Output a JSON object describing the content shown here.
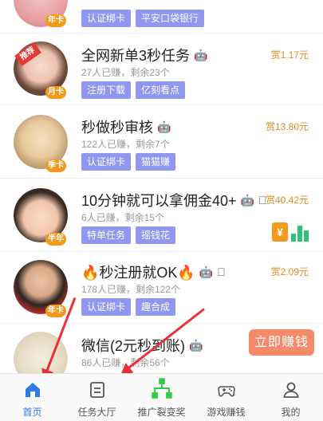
{
  "tasks": [
    {
      "title": "",
      "meta": "",
      "reward": "",
      "badge": "年卡",
      "ribbon": "",
      "tags": [
        "认证绑卡",
        "平安口袋银行"
      ]
    },
    {
      "title": "全网新单3秒任务",
      "meta": "27人已赚，剩余23个",
      "reward": "赏1.17元",
      "badge": "月卡",
      "ribbon": "推荐",
      "tags": [
        "注册下载",
        "亿刻看点"
      ]
    },
    {
      "title": "秒做秒审核",
      "meta": "122人已赚，剩余7个",
      "reward": "赏13.80元",
      "badge": "季卡",
      "ribbon": "",
      "tags": [
        "认证绑卡",
        "猫猫赚"
      ]
    },
    {
      "title": "10分钟就可以拿佣金40+",
      "meta": "6人已赚，剩余15个",
      "reward": "赏40.42元",
      "badge": "半年",
      "ribbon": "",
      "tags": [
        "特单任务",
        "摇钱花"
      ]
    },
    {
      "title": "🔥秒注册就OK🔥",
      "meta": "178人已赚，剩余122个",
      "reward": "赏2.09元",
      "badge": "年卡",
      "ribbon": "",
      "tags": [
        "认证绑卡",
        "趣合成"
      ]
    },
    {
      "title": "微信(2元秒到账)",
      "meta": "86人已赚，剩余56个",
      "reward": "",
      "badge": "",
      "ribbon": "",
      "tags": []
    }
  ],
  "money_icon": "¥",
  "cta": "立即赚钱",
  "tabbar": [
    {
      "label": "首页",
      "icon": "home-icon",
      "active": true
    },
    {
      "label": "任务大厅",
      "icon": "task-hall-icon",
      "active": false
    },
    {
      "label": "推广裂变奖",
      "icon": "referral-tree-icon",
      "active": false
    },
    {
      "label": "游戏赚钱",
      "icon": "gamepad-icon",
      "active": false
    },
    {
      "label": "我的",
      "icon": "user-icon",
      "active": false
    }
  ],
  "colors": {
    "tag": "#8f98ee",
    "reward": "#e08a1e",
    "active_tab": "#2f7be5",
    "cta": "#f58a6a",
    "annotation_arrow": "#e8303a"
  }
}
